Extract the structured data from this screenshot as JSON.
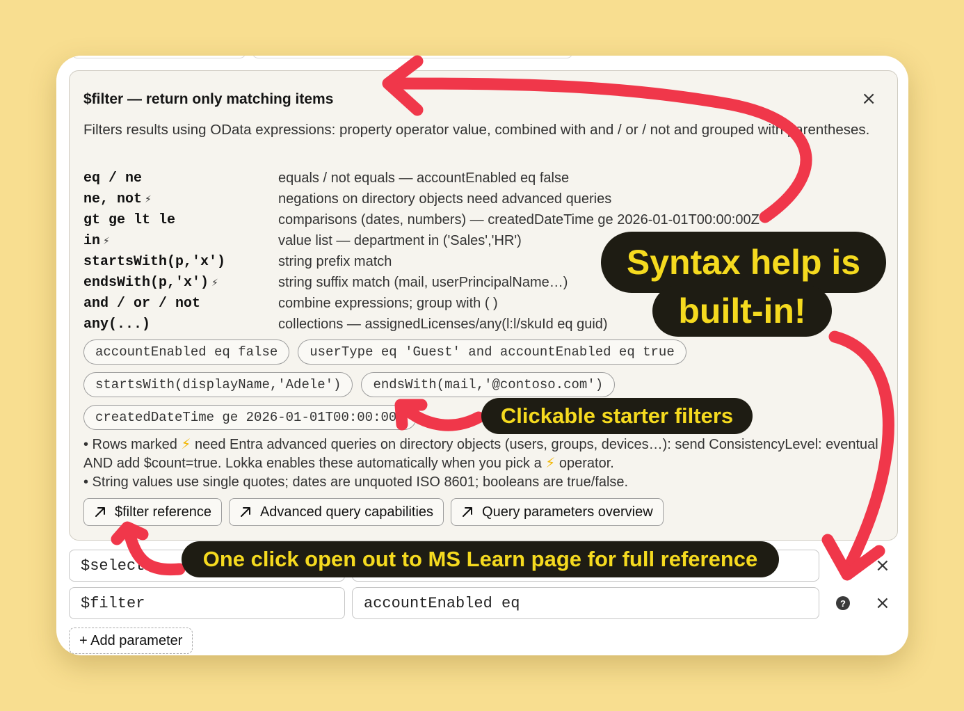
{
  "help": {
    "title": "$filter — return only matching items",
    "description": "Filters results using OData expressions: property operator value, combined with and / or / not and grouped with parentheses.",
    "operators": [
      {
        "code": "eq / ne",
        "bolt": "",
        "desc": "equals / not equals — accountEnabled eq false"
      },
      {
        "code": "ne, not",
        "bolt": "⚡",
        "desc": "negations on directory objects need advanced queries"
      },
      {
        "code": "gt ge lt le",
        "bolt": "",
        "desc": "comparisons (dates, numbers) — createdDateTime ge 2026-01-01T00:00:00Z"
      },
      {
        "code": "in",
        "bolt": "⚡",
        "desc": "value list — department in ('Sales','HR')"
      },
      {
        "code": "startsWith(p,'x')",
        "bolt": "",
        "desc": "string prefix match"
      },
      {
        "code": "endsWith(p,'x')",
        "bolt": "⚡",
        "desc": "string suffix match (mail, userPrincipalName…)"
      },
      {
        "code": "and / or / not",
        "bolt": "",
        "desc": "combine expressions; group with ( )"
      },
      {
        "code": "any(...)",
        "bolt": "",
        "desc": "collections — assignedLicenses/any(l:l/skuId eq guid)"
      }
    ],
    "chips_row1": [
      "accountEnabled eq false",
      "userType eq 'Guest' and accountEnabled eq true"
    ],
    "chips_row2": [
      "startsWith(displayName,'Adele')",
      "endsWith(mail,'@contoso.com')"
    ],
    "chips_row3": [
      "createdDateTime ge 2026-01-01T00:00:00Z"
    ],
    "note1_a": "• Rows marked ",
    "note1_b": " need Entra advanced queries on directory objects (users, groups, devices…): send ConsistencyLevel: eventual AND add $count=true. Lokka enables these automatically when you pick a ",
    "note1_c": " operator.",
    "note2": "• String values use single quotes; dates are unquoted ISO 8601; booleans are true/false.",
    "bolt_symbol": "⚡",
    "links": [
      "$filter reference",
      "Advanced query capabilities",
      "Query parameters overview"
    ]
  },
  "params": [
    {
      "name": "$select",
      "value": ""
    },
    {
      "name": "$filter",
      "value": "accountEnabled eq"
    }
  ],
  "add_parameter_label": "+ Add parameter",
  "help_icon_glyph": "?",
  "close_glyph": "×",
  "callouts": {
    "syntax_line1": "Syntax help is",
    "syntax_line2": "built-in!",
    "starter": "Clickable starter filters",
    "mslearn": "One click open out to MS Learn page for full reference"
  },
  "colors": {
    "background": "#f8de90",
    "callout_bg": "#1e1c13",
    "callout_text": "#f5da1f",
    "arrow": "#f0374a",
    "panel_bg": "#f6f4ee"
  },
  "icons": [
    "close-icon",
    "external-link-icon",
    "help-icon",
    "lightning-icon"
  ]
}
